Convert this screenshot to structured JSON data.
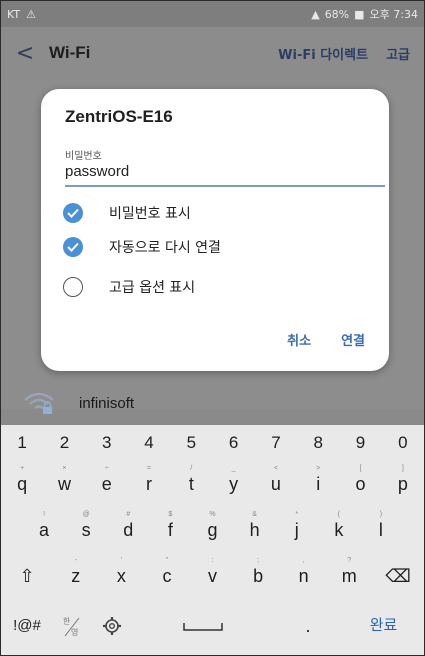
{
  "status_bar": {
    "carrier": "KT",
    "right_text": "68%",
    "time": "오후 7:34"
  },
  "app_bar": {
    "title": "Wi-Fi",
    "action_direct": "Wi-Fi 다이렉트",
    "action_advanced": "고급"
  },
  "background": {
    "network_name": "infinisoft"
  },
  "dialog": {
    "network": "ZentriOS-E16",
    "password_label": "비밀번호",
    "password_value": "password",
    "options": [
      {
        "label": "비밀번호 표시",
        "checked": true
      },
      {
        "label": "자동으로 다시 연결",
        "checked": true
      },
      {
        "label": "고급 옵션 표시",
        "checked": false
      }
    ],
    "cancel": "취소",
    "connect": "연결"
  },
  "keyboard": {
    "numbers": [
      "1",
      "2",
      "3",
      "4",
      "5",
      "6",
      "7",
      "8",
      "9",
      "0"
    ],
    "row1": [
      "q",
      "w",
      "e",
      "r",
      "t",
      "y",
      "u",
      "i",
      "o",
      "p"
    ],
    "row1_sup": [
      "+",
      "×",
      "÷",
      "=",
      "/",
      "_",
      "<",
      ">",
      "[",
      "]"
    ],
    "row2": [
      "a",
      "s",
      "d",
      "f",
      "g",
      "h",
      "j",
      "k",
      "l"
    ],
    "row2_sup": [
      "!",
      "@",
      "#",
      "$",
      "%",
      "&",
      "*",
      "(",
      ")"
    ],
    "row3": [
      "z",
      "x",
      "c",
      "v",
      "b",
      "n",
      "m"
    ],
    "row3_sup": [
      "-",
      "'",
      "\"",
      ":",
      ";",
      ",",
      "?"
    ],
    "symbols_key": "!@#",
    "done_key": "완료",
    "period_key": "."
  }
}
